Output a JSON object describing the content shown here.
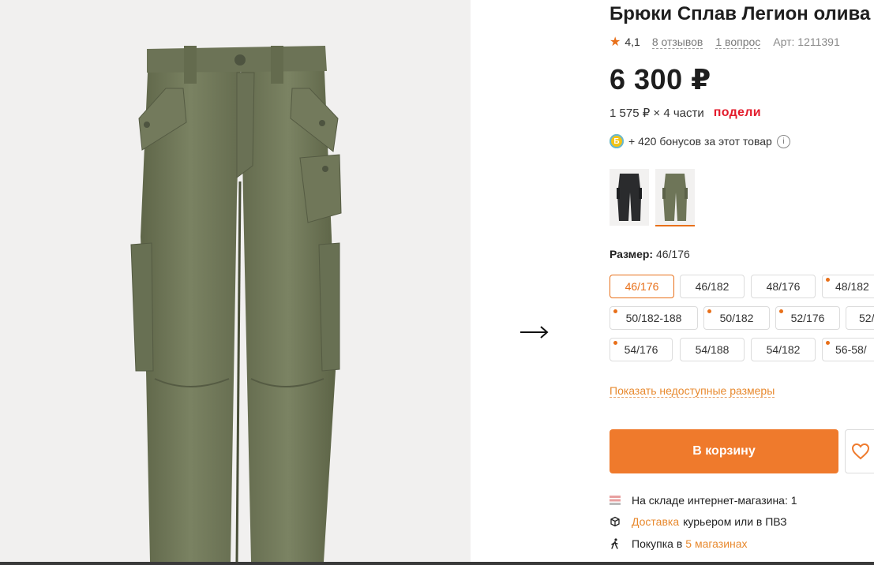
{
  "product": {
    "title": "Брюки Сплав Легион олива",
    "rating": "4,1",
    "reviews": "8 отзывов",
    "questions": "1 вопрос",
    "article": "Арт: 1211391",
    "price": "6 300 ₽",
    "installment": "1 575 ₽ × 4 части",
    "installment_provider": "подели",
    "bonus_text": "+ 420 бонусов за этот товар",
    "bonus_badge": "Б",
    "info_mark": "i"
  },
  "colors": {
    "accent": "#e8701a",
    "cart_button": "#ef7a2c",
    "podeli": "#e31b2b",
    "olive": "#6e7558"
  },
  "variants": [
    {
      "name": "black",
      "selected": false
    },
    {
      "name": "olive",
      "selected": true
    }
  ],
  "size": {
    "label": "Размер:",
    "selected": "46/176",
    "options": [
      {
        "label": "46/176",
        "active": true,
        "marked": false
      },
      {
        "label": "46/182",
        "active": false,
        "marked": false
      },
      {
        "label": "48/176",
        "active": false,
        "marked": false
      },
      {
        "label": "48/182",
        "active": false,
        "marked": true
      },
      {
        "label": "50/182-188",
        "active": false,
        "marked": true
      },
      {
        "label": "50/182",
        "active": false,
        "marked": true
      },
      {
        "label": "52/176",
        "active": false,
        "marked": true
      },
      {
        "label": "52/",
        "active": false,
        "marked": false
      },
      {
        "label": "54/176",
        "active": false,
        "marked": true
      },
      {
        "label": "54/188",
        "active": false,
        "marked": false
      },
      {
        "label": "54/182",
        "active": false,
        "marked": false
      },
      {
        "label": "56-58/",
        "active": false,
        "marked": true
      }
    ],
    "show_unavailable": "Показать недоступные размеры"
  },
  "actions": {
    "cart": "В корзину",
    "favorite_icon": "heart-icon"
  },
  "availability": {
    "stock": "На складе интернет-магазина: 1",
    "delivery_link": "Доставка",
    "delivery_text": "курьером или в ПВЗ",
    "pickup_text": "Покупка в",
    "pickup_link": "5 магазинах"
  },
  "gallery": {
    "next_icon": "arrow-right-icon"
  }
}
